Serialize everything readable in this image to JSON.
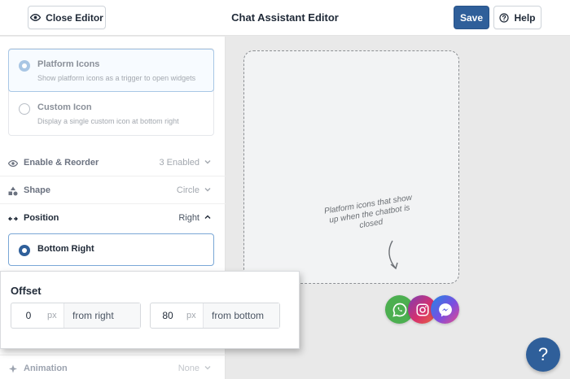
{
  "header": {
    "close_label": "Close Editor",
    "title": "Chat Assistant Editor",
    "save_label": "Save",
    "help_label": "Help"
  },
  "trigger_options": [
    {
      "title": "Platform Icons",
      "desc": "Show platform icons as a trigger to open widgets",
      "selected": true
    },
    {
      "title": "Custom Icon",
      "desc": "Display a single custom icon at bottom right",
      "selected": false
    }
  ],
  "sections": {
    "enable": {
      "label": "Enable & Reorder",
      "value": "3 Enabled",
      "icon": "eye-icon"
    },
    "shape": {
      "label": "Shape",
      "value": "Circle",
      "icon": "shapes-icon"
    },
    "position": {
      "label": "Position",
      "value": "Right",
      "icon": "position-icon"
    },
    "animation": {
      "label": "Animation",
      "value": "None",
      "icon": "sparkle-icon"
    }
  },
  "position_option": {
    "label": "Bottom Right",
    "selected": true
  },
  "offset": {
    "title": "Offset",
    "right": {
      "value": "0",
      "unit": "px",
      "label": "from right"
    },
    "bottom": {
      "value": "80",
      "unit": "px",
      "label": "from bottom"
    }
  },
  "preview": {
    "note": "Platform icons that show up when the chatbot is closed",
    "icons": [
      "whatsapp-icon",
      "instagram-icon",
      "messenger-icon"
    ]
  },
  "help_fab": "?",
  "colors": {
    "primary": "#2f5f9a",
    "whatsapp": "#4caf50"
  }
}
